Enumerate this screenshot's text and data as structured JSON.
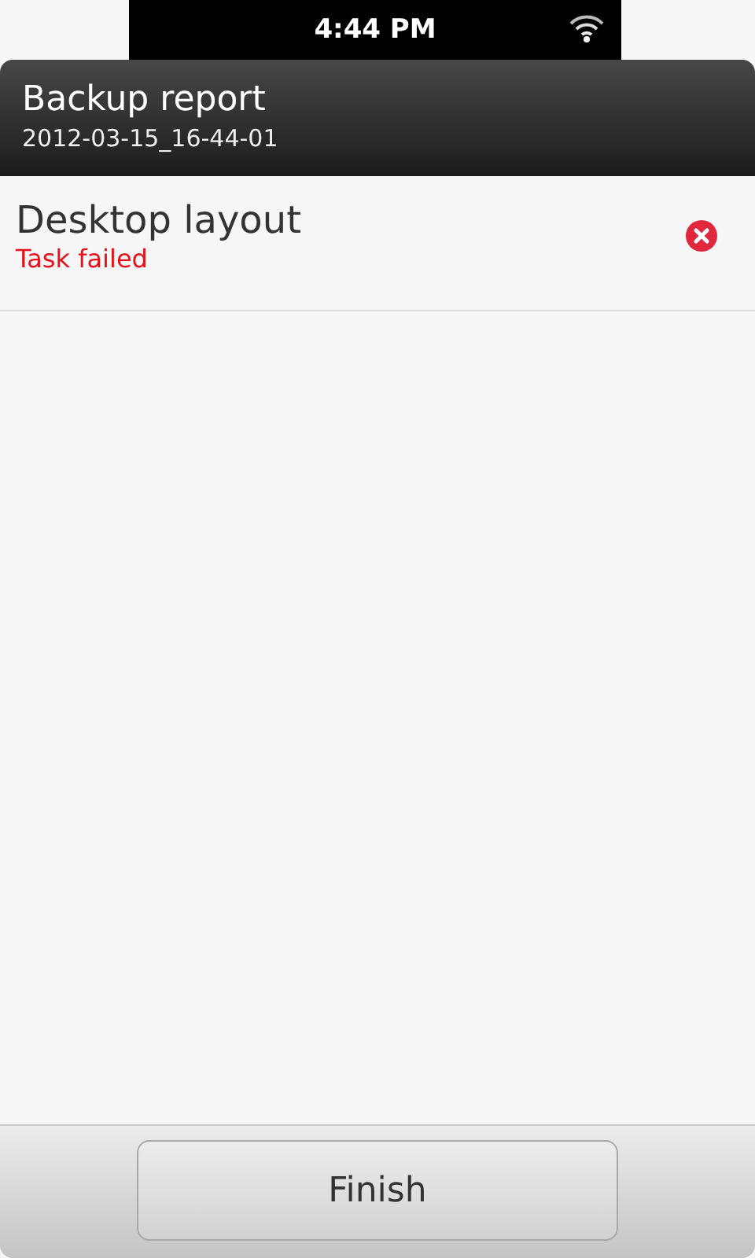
{
  "status_bar": {
    "time": "4:44 PM"
  },
  "header": {
    "title": "Backup report",
    "subtitle": "2012-03-15_16-44-01"
  },
  "tasks": [
    {
      "name": "Desktop layout",
      "status_text": "Task failed",
      "failed": true
    }
  ],
  "footer": {
    "button": "Finish"
  }
}
